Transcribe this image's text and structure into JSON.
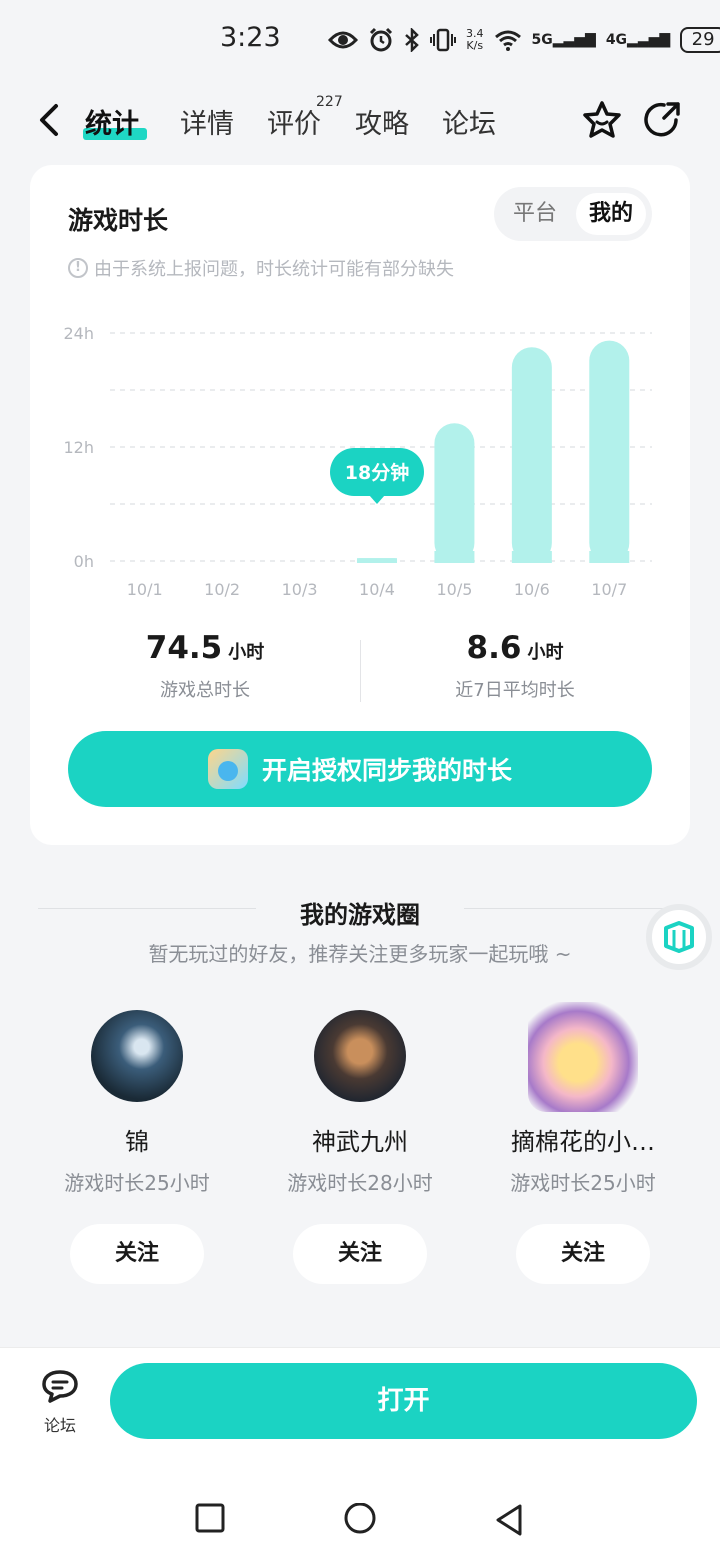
{
  "status_bar": {
    "time": "3:23",
    "net_speed_value": "3.4",
    "net_speed_unit": "K/s",
    "signal_1": "5G",
    "signal_2": "4G",
    "battery": "29"
  },
  "tabs": [
    {
      "label": "统计",
      "active": true
    },
    {
      "label": "详情",
      "active": false
    },
    {
      "label": "评价",
      "active": false,
      "badge": "227"
    },
    {
      "label": "攻略",
      "active": false
    },
    {
      "label": "论坛",
      "active": false
    }
  ],
  "card": {
    "title": "游戏时长",
    "toggle": {
      "platform": "平台",
      "mine": "我的"
    },
    "notice": "由于系统上报问题，时长统计可能有部分缺失",
    "total": {
      "value": "74.5",
      "unit": "小时",
      "label": "游戏总时长"
    },
    "average": {
      "value": "8.6",
      "unit": "小时",
      "label": "近7日平均时长"
    },
    "sync_button": "开启授权同步我的时长"
  },
  "chart_data": {
    "type": "bar",
    "categories": [
      "10/1",
      "10/2",
      "10/3",
      "10/4",
      "10/5",
      "10/6",
      "10/7"
    ],
    "values": [
      0,
      0,
      0,
      0.3,
      14.5,
      22.5,
      23.2
    ],
    "y_ticks": [
      "24h",
      "12h",
      "0h"
    ],
    "ylim": [
      0,
      24
    ],
    "tooltip": {
      "category": "10/4",
      "text": "18分钟"
    },
    "grid": true,
    "bar_color": "#b2f1eb",
    "tooltip_color": "#1bd3c3"
  },
  "game_circle": {
    "title": "我的游戏圈",
    "subtitle": "暂无玩过的好友，推荐关注更多玩家一起玩哦 ~",
    "friends": [
      {
        "name": "锦",
        "time": "游戏时长25小时",
        "follow": "关注"
      },
      {
        "name": "神武九州",
        "time": "游戏时长28小时",
        "follow": "关注"
      },
      {
        "name": "摘棉花的小…",
        "time": "游戏时长25小时",
        "follow": "关注"
      }
    ]
  },
  "bottom_bar": {
    "forum_label": "论坛",
    "open_button": "打开"
  },
  "colors": {
    "accent": "#1bd3c3",
    "bar": "#b2f1eb"
  }
}
